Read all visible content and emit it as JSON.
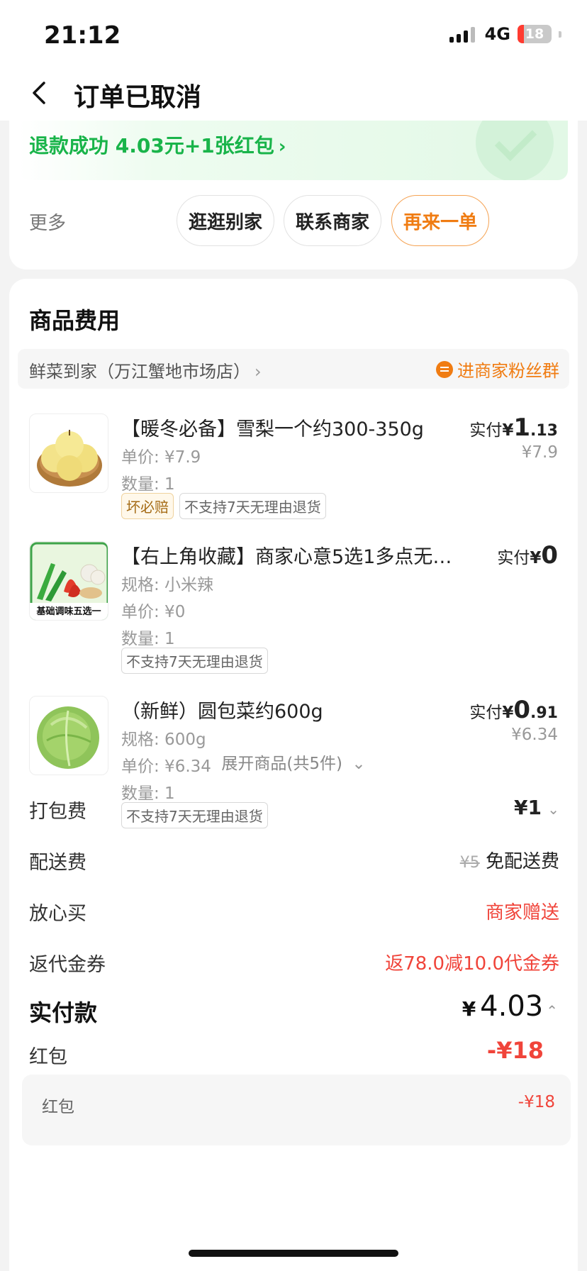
{
  "status_bar": {
    "time": "21:12",
    "network": "4G",
    "battery": "18",
    "battery_level": 0.18
  },
  "nav": {
    "title": "订单已取消"
  },
  "refund": {
    "text": "退款成功 4.03元+1张红包",
    "arrow": "›"
  },
  "actions": {
    "more": "更多",
    "browse_label": "逛逛别家",
    "contact_label": "联系商家",
    "reorder_label": "再来一单"
  },
  "goods": {
    "section_title": "商品费用",
    "store_name": "鲜菜到家（万江蟹地市场店）",
    "store_arrow": "›",
    "fan_group": "进商家粉丝群",
    "items": [
      {
        "title": "【暖冬必备】雪梨一个约300-350g",
        "lines": [
          "单价: ¥7.9",
          "数量: 1"
        ],
        "pay_prefix": "实付",
        "yen": "¥",
        "pay_int": "1",
        "pay_dec": ".13",
        "original": "¥7.9",
        "tags": [
          "坏必赔",
          "不支持7天无理由退货"
        ],
        "thumb_caption": ""
      },
      {
        "title": "【右上角收藏】商家心意5选1多点无…",
        "lines": [
          "规格: 小米辣",
          "单价: ¥0",
          "数量: 1"
        ],
        "pay_prefix": "实付",
        "yen": "¥",
        "pay_int": "0",
        "pay_dec": "",
        "original": "",
        "tags": [
          "不支持7天无理由退货"
        ],
        "thumb_caption": "基础调味五选一"
      },
      {
        "title": "（新鲜）圆包菜约600g",
        "lines": [
          "规格: 600g",
          "单价: ¥6.34",
          "数量: 1"
        ],
        "pay_prefix": "实付",
        "yen": "¥",
        "pay_int": "0",
        "pay_dec": ".91",
        "original": "¥6.34",
        "tags": [
          "不支持7天无理由退货"
        ],
        "thumb_caption": ""
      }
    ],
    "expand_label": "展开商品(共5件)",
    "expand_icon": "⌄"
  },
  "fees": {
    "packing": {
      "label": "打包费",
      "value": "¥1",
      "icon": "⌄"
    },
    "delivery": {
      "label": "配送费",
      "original": "¥5",
      "value": "免配送费"
    },
    "assurance": {
      "label": "放心买",
      "value": "商家赠送"
    },
    "coupon": {
      "label": "返代金券",
      "value": "返78.0减10.0代金券"
    }
  },
  "total": {
    "label": "实付款",
    "yen": "¥",
    "value": "4.03",
    "icon": "⌃"
  },
  "red_packet": {
    "label": "红包",
    "value": "-¥18",
    "sub_label": "红包",
    "sub_value": "-¥18"
  },
  "colors": {
    "green": "#19b44a",
    "orange": "#f07c12",
    "red": "#f0443a"
  }
}
